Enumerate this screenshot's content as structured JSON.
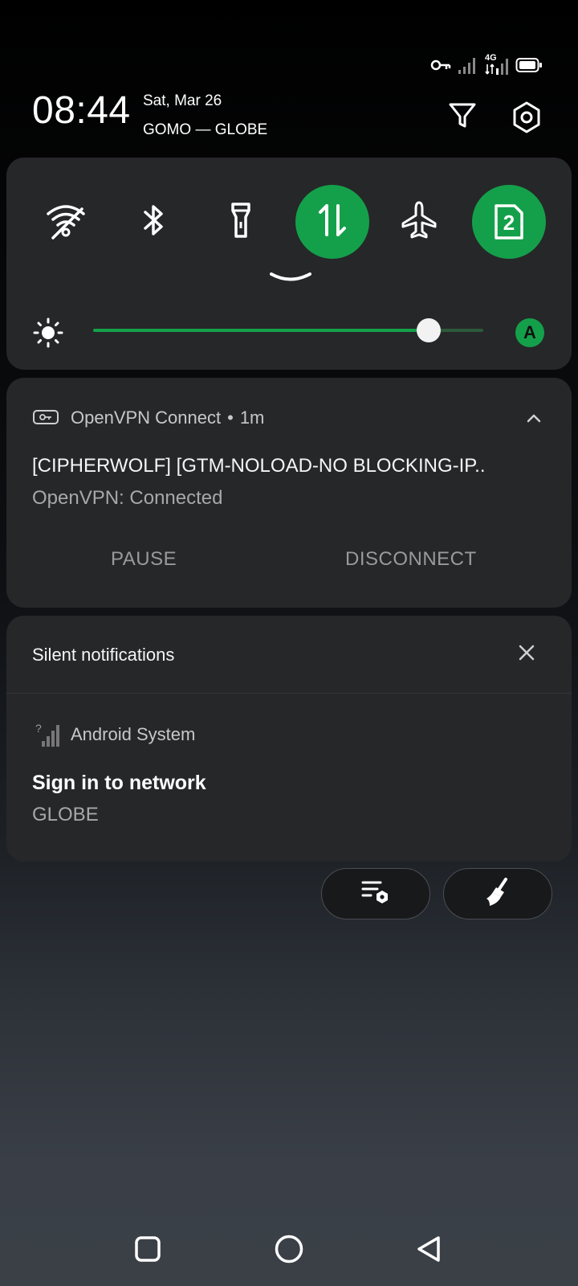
{
  "status_bar": {
    "network_type": "4G",
    "icons": [
      "vpn-key-icon",
      "signal-sim1-icon",
      "signal-sim2-icon",
      "battery-icon"
    ]
  },
  "header": {
    "time": "08:44",
    "date": "Sat, Mar 26",
    "carrier": "GOMO — GLOBE",
    "icons": [
      "filter-icon",
      "settings-icon"
    ]
  },
  "quick_settings": {
    "tiles": [
      {
        "icon": "wifi-off-icon",
        "active": false
      },
      {
        "icon": "bluetooth-icon",
        "active": false
      },
      {
        "icon": "flashlight-icon",
        "active": false
      },
      {
        "icon": "mobile-data-icon",
        "active": true
      },
      {
        "icon": "airplane-icon",
        "active": false
      },
      {
        "icon": "sim-2-icon",
        "active": true,
        "label": "2"
      }
    ],
    "brightness": {
      "level": 0.86,
      "auto_label": "A"
    },
    "accent_color": "#14a04a"
  },
  "vpn_notification": {
    "app_name": "OpenVPN Connect",
    "separator": "•",
    "time": "1m",
    "title": "[CIPHERWOLF] [GTM-NOLOAD-NO BLOCKING-IP..",
    "text": "OpenVPN: Connected",
    "actions": {
      "pause": "PAUSE",
      "disconnect": "DISCONNECT"
    }
  },
  "silent_notifications": {
    "header": "Silent notifications",
    "items": [
      {
        "app": "Android System",
        "title": "Sign in to network",
        "text": "GLOBE"
      }
    ]
  },
  "bottom_actions": [
    "notification-settings-icon",
    "clear-all-icon"
  ],
  "nav_bar": [
    "recents-icon",
    "home-icon",
    "back-icon"
  ]
}
